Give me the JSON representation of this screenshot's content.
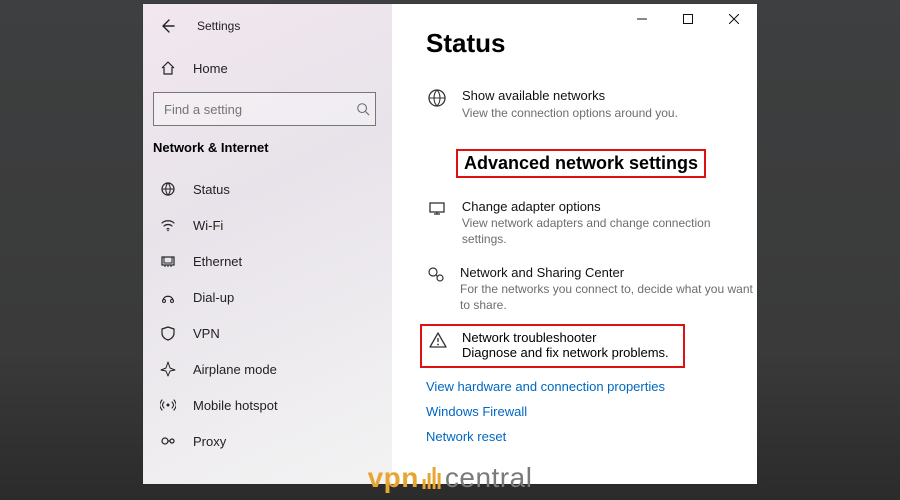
{
  "window": {
    "back_aria": "Back",
    "title": "Settings",
    "controls": {
      "min": "Minimize",
      "max": "Maximize",
      "close": "Close"
    }
  },
  "sidebar": {
    "home": "Home",
    "search_placeholder": "Find a setting",
    "category": "Network & Internet",
    "items": [
      {
        "id": "status",
        "label": "Status"
      },
      {
        "id": "wifi",
        "label": "Wi-Fi"
      },
      {
        "id": "ethernet",
        "label": "Ethernet"
      },
      {
        "id": "dialup",
        "label": "Dial-up"
      },
      {
        "id": "vpn",
        "label": "VPN"
      },
      {
        "id": "airplane",
        "label": "Airplane mode"
      },
      {
        "id": "hotspot",
        "label": "Mobile hotspot"
      },
      {
        "id": "proxy",
        "label": "Proxy"
      }
    ]
  },
  "main": {
    "page_title": "Status",
    "available": {
      "title": "Show available networks",
      "desc": "View the connection options around you."
    },
    "section_heading": "Advanced network settings",
    "adapter": {
      "title": "Change adapter options",
      "desc": "View network adapters and change connection settings."
    },
    "sharing": {
      "title": "Network and Sharing Center",
      "desc": "For the networks you connect to, decide what you want to share."
    },
    "troubleshooter": {
      "title": "Network troubleshooter",
      "desc": "Diagnose and fix network problems."
    },
    "links": {
      "hwprops": "View hardware and connection properties",
      "firewall": "Windows Firewall",
      "reset": "Network reset"
    }
  },
  "watermark": {
    "left": "vpn",
    "right": "central"
  },
  "colors": {
    "highlight": "#d11",
    "link": "#0067c0",
    "accent": "#e7a532"
  }
}
